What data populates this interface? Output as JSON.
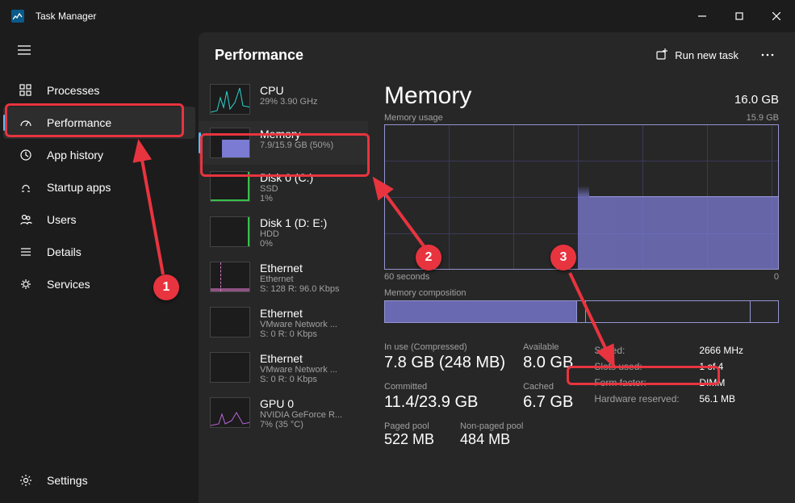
{
  "window": {
    "title": "Task Manager"
  },
  "header": {
    "title": "Performance",
    "run_task": "Run new task"
  },
  "nav": {
    "items": [
      {
        "label": "Processes"
      },
      {
        "label": "Performance"
      },
      {
        "label": "App history"
      },
      {
        "label": "Startup apps"
      },
      {
        "label": "Users"
      },
      {
        "label": "Details"
      },
      {
        "label": "Services"
      }
    ],
    "settings": "Settings"
  },
  "perf_list": [
    {
      "name": "CPU",
      "sub": "29% 3.90 GHz"
    },
    {
      "name": "Memory",
      "sub": "7.9/15.9 GB (50%)"
    },
    {
      "name": "Disk 0 (C:)",
      "sub1": "SSD",
      "sub2": "1%"
    },
    {
      "name": "Disk 1 (D: E:)",
      "sub1": "HDD",
      "sub2": "0%"
    },
    {
      "name": "Ethernet",
      "sub1": "Ethernet",
      "sub2": "S: 128 R: 96.0 Kbps"
    },
    {
      "name": "Ethernet",
      "sub1": "VMware Network ...",
      "sub2": "S: 0 R: 0 Kbps"
    },
    {
      "name": "Ethernet",
      "sub1": "VMware Network ...",
      "sub2": "S: 0 R: 0 Kbps"
    },
    {
      "name": "GPU 0",
      "sub1": "NVIDIA GeForce R...",
      "sub2": "7% (35 °C)"
    }
  ],
  "detail": {
    "title": "Memory",
    "capacity": "16.0 GB",
    "usage_label": "Memory usage",
    "usage_max": "15.9 GB",
    "x_left": "60 seconds",
    "x_right": "0",
    "comp_label": "Memory composition",
    "stats": {
      "inuse_label": "In use (Compressed)",
      "inuse_value": "7.8 GB (248 MB)",
      "available_label": "Available",
      "available_value": "8.0 GB",
      "committed_label": "Committed",
      "committed_value": "11.4/23.9 GB",
      "cached_label": "Cached",
      "cached_value": "6.7 GB",
      "paged_label": "Paged pool",
      "paged_value": "522 MB",
      "nonpaged_label": "Non-paged pool",
      "nonpaged_value": "484 MB"
    },
    "kv": {
      "speed_k": "Speed:",
      "speed_v": "2666 MHz",
      "slots_k": "Slots used:",
      "slots_v": "1 of 4",
      "form_k": "Form factor:",
      "form_v": "DIMM",
      "hw_k": "Hardware reserved:",
      "hw_v": "56.1 MB"
    }
  },
  "annotations": {
    "n1": "1",
    "n2": "2",
    "n3": "3"
  },
  "chart_data": {
    "type": "area",
    "title": "Memory usage",
    "xlabel": "seconds ago",
    "ylabel": "GB",
    "x": [
      60,
      30,
      28,
      0
    ],
    "values": [
      0,
      0,
      7.9,
      7.9
    ],
    "ylim": [
      0,
      15.9
    ],
    "xlim": [
      60,
      0
    ],
    "composition": {
      "in_use_gb": 7.8,
      "modified_gb": 0.2,
      "standby_gb": 6.7,
      "free_gb": 1.2,
      "total_gb": 15.9
    }
  }
}
